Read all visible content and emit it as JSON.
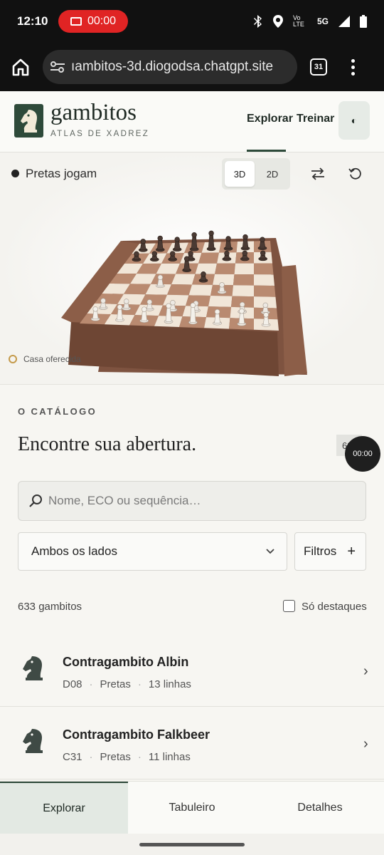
{
  "status_bar": {
    "time": "12:10",
    "recording": "00:00",
    "network": "5G",
    "lte_label": "Vo LTE"
  },
  "browser": {
    "url": "ıambitos-3d.diogodsa.chatgpt.site",
    "tab_count": "31"
  },
  "header": {
    "brand": "gambitos",
    "tagline": "ATLAS DE XADREZ",
    "nav": [
      "Explorar",
      "Treinar"
    ],
    "theme_icon": "◐"
  },
  "board": {
    "turn": "Pretas jogam",
    "view_3d": "3D",
    "view_2d": "2D",
    "legend": "Casa oferecida"
  },
  "catalog": {
    "eyebrow": "O CATÁLOGO",
    "title": "Encontre sua abertura.",
    "count_chip": "633",
    "overlay_timer": "00:00",
    "search_placeholder": "Nome, ECO ou sequência…",
    "side_select": "Ambos os lados",
    "filters_label": "Filtros",
    "filters_icon": "+",
    "result_count": "633 gambitos",
    "highlights_label": "Só destaques",
    "items": [
      {
        "name": "Contragambito Albin",
        "eco": "D08",
        "side": "Pretas",
        "lines": "13 linhas"
      },
      {
        "name": "Contragambito Falkbeer",
        "eco": "C31",
        "side": "Pretas",
        "lines": "11 linhas"
      }
    ]
  },
  "bottom_tabs": [
    "Explorar",
    "Tabuleiro",
    "Detalhes"
  ],
  "colors": {
    "brand_green": "#2e4a3a",
    "record_red": "#e02424"
  }
}
